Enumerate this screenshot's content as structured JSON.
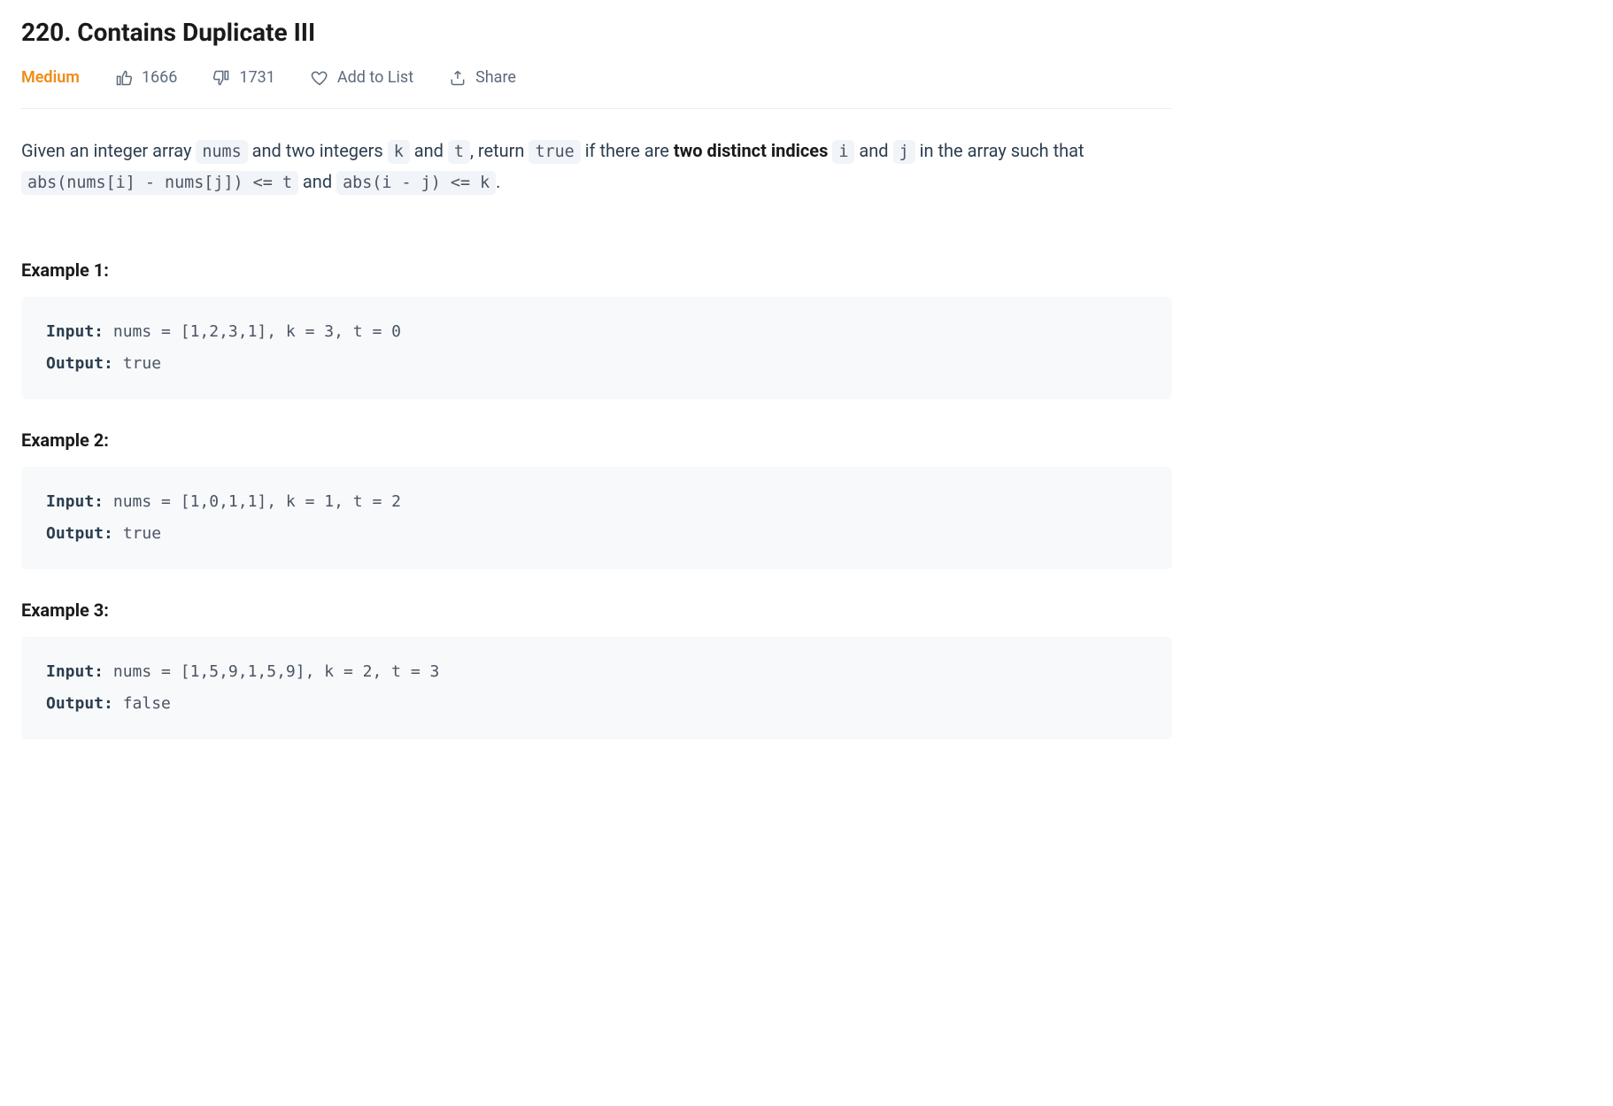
{
  "title": "220. Contains Duplicate III",
  "meta": {
    "difficulty": "Medium",
    "likes": "1666",
    "dislikes": "1731",
    "add_to_list": "Add to List",
    "share": "Share"
  },
  "description": {
    "p1_a": "Given an integer array ",
    "p1_nums": "nums",
    "p1_b": " and two integers ",
    "p1_k": "k",
    "p1_c": " and ",
    "p1_t": "t",
    "p1_d": ", return ",
    "p1_true": "true",
    "p1_e": " if there are ",
    "p1_bold": "two distinct indices",
    "p1_f": " ",
    "p1_i": "i",
    "p1_g": " and ",
    "p1_j": "j",
    "p1_h": " in the array such that ",
    "p1_expr1": "abs(nums[i] - nums[j]) <= t",
    "p1_i2": " and ",
    "p1_expr2": "abs(i - j) <= k",
    "p1_j2": "."
  },
  "examples": [
    {
      "heading": "Example 1:",
      "input_label": "Input:",
      "input_value": " nums = [1,2,3,1], k = 3, t = 0",
      "output_label": "Output:",
      "output_value": " true"
    },
    {
      "heading": "Example 2:",
      "input_label": "Input:",
      "input_value": " nums = [1,0,1,1], k = 1, t = 2",
      "output_label": "Output:",
      "output_value": " true"
    },
    {
      "heading": "Example 3:",
      "input_label": "Input:",
      "input_value": " nums = [1,5,9,1,5,9], k = 2, t = 3",
      "output_label": "Output:",
      "output_value": " false"
    }
  ]
}
